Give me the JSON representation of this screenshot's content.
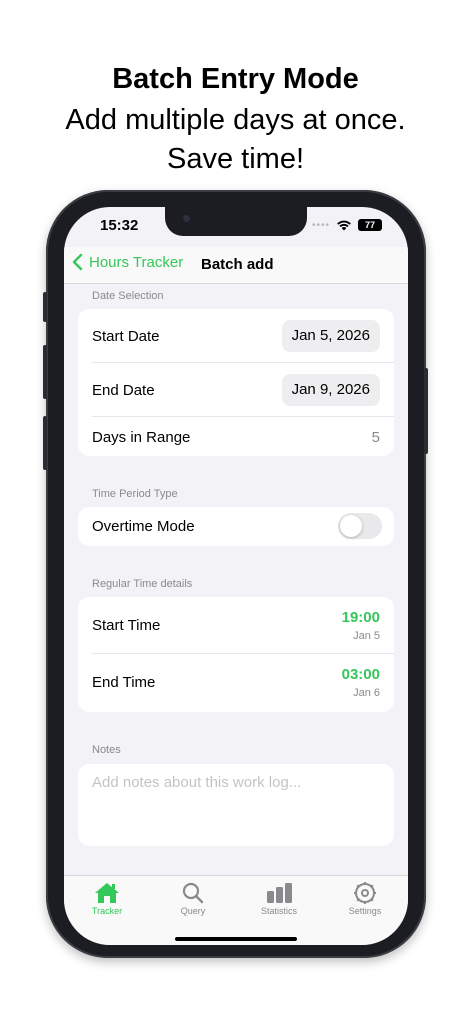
{
  "promo": {
    "title": "Batch Entry Mode",
    "subtitle_line1": "Add multiple days at once.",
    "subtitle_line2": "Save time!"
  },
  "status_bar": {
    "time": "15:32",
    "battery": "77"
  },
  "nav": {
    "back_label": "Hours Tracker",
    "title": "Batch add"
  },
  "date_selection": {
    "header": "Date Selection",
    "start_label": "Start Date",
    "start_value": "Jan 5, 2026",
    "end_label": "End Date",
    "end_value": "Jan 9, 2026",
    "range_label": "Days in Range",
    "range_value": "5"
  },
  "period_type": {
    "header": "Time Period Type",
    "overtime_label": "Overtime Mode",
    "overtime_on": false
  },
  "regular_time": {
    "header": "Regular Time details",
    "start_label": "Start Time",
    "start_time": "19:00",
    "start_date": "Jan 5",
    "end_label": "End Time",
    "end_time": "03:00",
    "end_date": "Jan 6"
  },
  "notes": {
    "header": "Notes",
    "placeholder": "Add notes about this work log..."
  },
  "tabs": [
    {
      "label": "Tracker",
      "icon": "house-icon",
      "active": true
    },
    {
      "label": "Query",
      "icon": "magnifier-icon",
      "active": false
    },
    {
      "label": "Statistics",
      "icon": "bar-chart-icon",
      "active": false
    },
    {
      "label": "Settings",
      "icon": "gear-icon",
      "active": false
    }
  ],
  "colors": {
    "accent": "#34c759",
    "background": "#f2f2f7",
    "secondary_text": "#8a8a8e"
  }
}
